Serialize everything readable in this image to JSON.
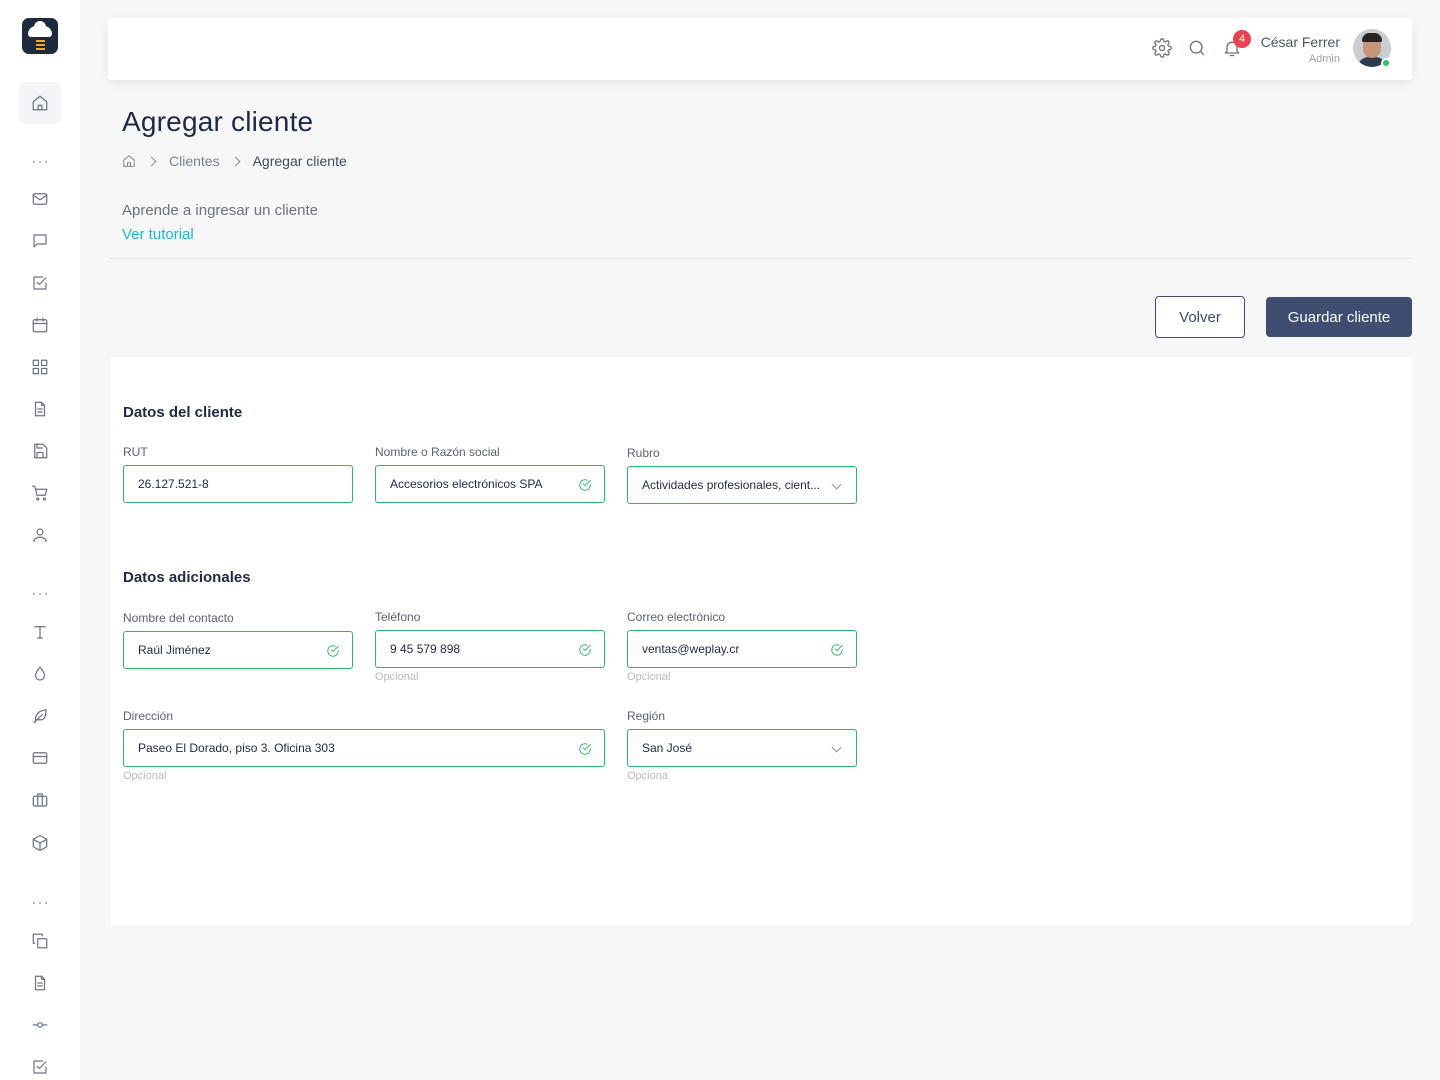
{
  "header": {
    "user_name": "César Ferrer",
    "user_role": "Admin",
    "notifications_count": "4"
  },
  "page": {
    "title": "Agregar cliente",
    "breadcrumb": [
      "Clientes",
      "Agregar cliente"
    ],
    "tutorial_text": "Aprende a ingresar un cliente",
    "tutorial_link": "Ver tutorial"
  },
  "actions": {
    "back_label": "Volver",
    "save_label": "Guardar cliente"
  },
  "form": {
    "client_section": "Datos del cliente",
    "rut": {
      "label": "RUT",
      "value": "26.127.521-8"
    },
    "name": {
      "label": "Nombre o Razón social",
      "value": "Accesorios electrónicos SPA"
    },
    "rubro": {
      "label": "Rubro",
      "value": "Actividades profesionales, cient..."
    },
    "additional_section": "Datos adicionales",
    "contact": {
      "label": "Nombre del contacto",
      "value": "Raúl Jiménez"
    },
    "phone": {
      "label": "Teléfono",
      "value": "9 45 579 898",
      "hint": "Opcional"
    },
    "email": {
      "label": "Correo electrónico",
      "value": "ventas@weplay.cr",
      "hint": "Opcional"
    },
    "address": {
      "label": "Dirección",
      "value": "Paseo El Dorado, piso 3. Oficina 303",
      "hint": "Opcional"
    },
    "region": {
      "label": "Región",
      "value": "San José",
      "hint": "Opciona"
    }
  },
  "colors": {
    "primary": "#3e4d70",
    "valid": "#2eb766",
    "link": "#1fb6d6",
    "badge": "#e8434e"
  },
  "icons": {
    "sidebar": [
      "home-icon",
      "mail-icon",
      "chat-icon",
      "checkbox-icon",
      "calendar-icon",
      "grid-icon",
      "document-icon",
      "save-icon",
      "cart-icon",
      "user-icon",
      "text-icon",
      "drop-icon",
      "feather-icon",
      "credit-card-icon",
      "briefcase-icon",
      "box-icon",
      "copy-icon",
      "file-icon",
      "git-commit-icon",
      "check-square-icon"
    ],
    "topbar": [
      "settings-icon",
      "search-icon",
      "bell-icon"
    ]
  }
}
